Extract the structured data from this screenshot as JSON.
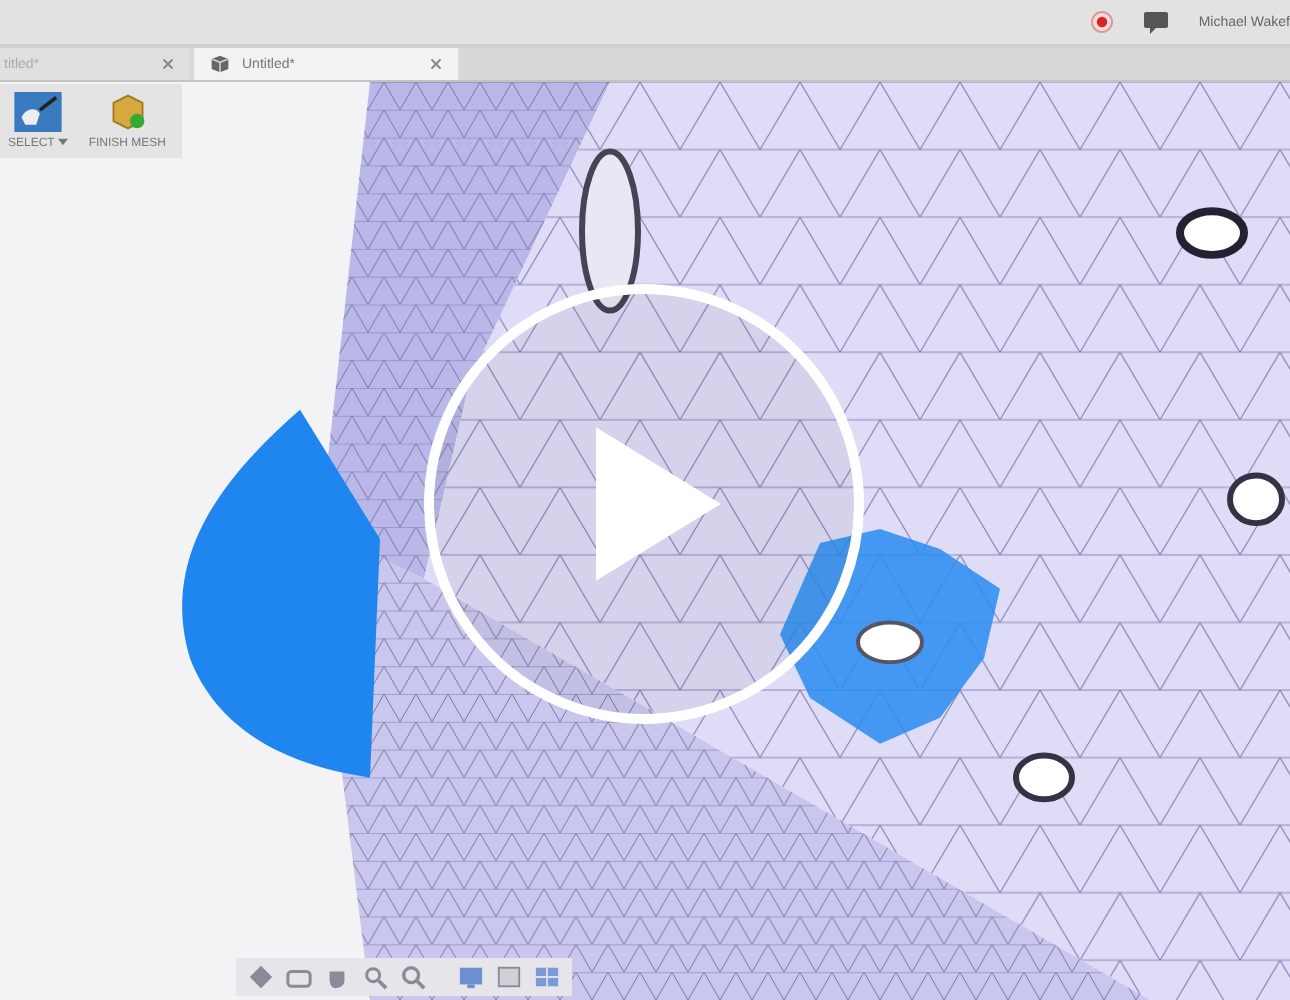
{
  "app_bar": {
    "user_name": "Michael Wakef"
  },
  "tabs": [
    {
      "label": "titled*",
      "selected": false
    },
    {
      "label": "Untitled*",
      "selected": true
    }
  ],
  "toolbar": [
    {
      "label": "SELECT",
      "kind": "dropdown"
    },
    {
      "label": "FINISH MESH",
      "kind": "plain"
    }
  ]
}
